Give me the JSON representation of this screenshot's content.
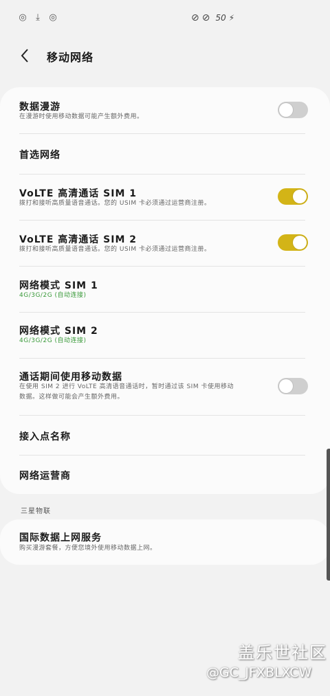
{
  "status_bar": {
    "left_icons": [
      "weibo-icon",
      "download-icon",
      "weibo-icon"
    ],
    "right_icons": [
      "do-not-disturb-icon",
      "mute-icon"
    ],
    "battery": "50"
  },
  "header": {
    "title": "移动网络"
  },
  "settings": {
    "data_roaming": {
      "title": "数据漫游",
      "subtitle": "在漫游时使用移动数据可能产生额外费用。",
      "enabled": false
    },
    "preferred_network": {
      "title": "首选网络"
    },
    "volte_sim1": {
      "title": "VoLTE 高清通话 SIM 1",
      "subtitle": "拨打和接听高质量语音通话。您的 USIM 卡必须通过运营商注册。",
      "enabled": true
    },
    "volte_sim2": {
      "title": "VoLTE 高清通话 SIM 2",
      "subtitle": "拨打和接听高质量语音通话。您的 USIM 卡必须通过运营商注册。",
      "enabled": true
    },
    "network_mode_sim1": {
      "title": "网络模式 SIM 1",
      "value": "4G/3G/2G (自动连接)"
    },
    "network_mode_sim2": {
      "title": "网络模式 SIM 2",
      "value": "4G/3G/2G (自动连接)"
    },
    "call_data": {
      "title": "通话期间使用移动数据",
      "subtitle_line1": "在使用 SIM 2 进行 VoLTE 高清语音通话时，暂时通过该 SIM 卡使用移动",
      "subtitle_line2": "数据。这样做可能会产生额外费用。",
      "enabled": false
    },
    "apn": {
      "title": "接入点名称"
    },
    "operators": {
      "title": "网络运营商"
    }
  },
  "section": {
    "label": "三星物联"
  },
  "global_data": {
    "title": "国际数据上网服务",
    "subtitle": "购买漫游套餐，方便您境外使用移动数据上网。"
  },
  "watermark": {
    "line1": "盖乐世社区",
    "line2": "@GC_JFXBLXCW"
  },
  "colors": {
    "toggle_on": "#d3b417",
    "toggle_off": "#cfcfcf",
    "accent_green": "#3a9a3a"
  }
}
